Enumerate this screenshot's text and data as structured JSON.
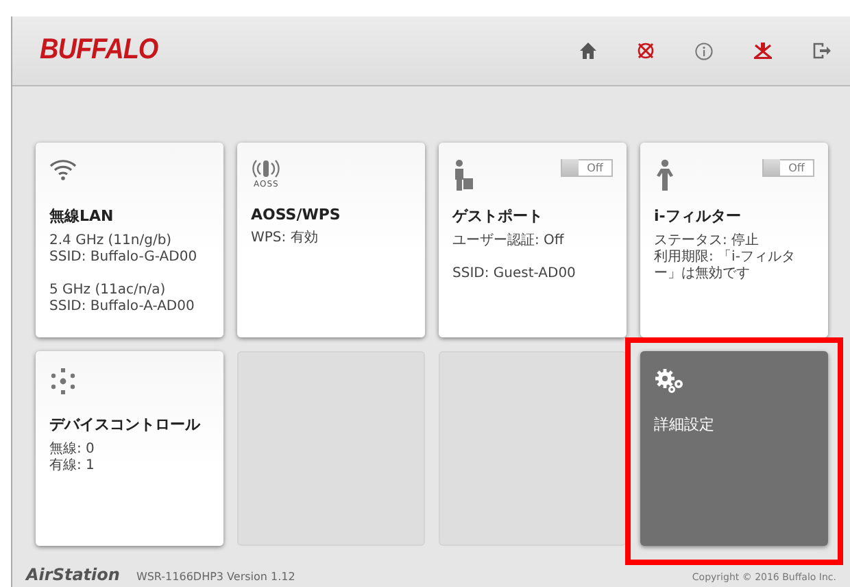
{
  "header": {
    "logo": "BUFFALO"
  },
  "tiles": [
    {
      "kind": "tile",
      "title": "無線LAN",
      "groups": [
        [
          "2.4 GHz (11n/g/b)",
          "SSID: Buffalo-G-AD00"
        ],
        [
          "5 GHz (11ac/n/a)",
          "SSID: Buffalo-A-AD00"
        ]
      ]
    },
    {
      "kind": "tile",
      "icon_caption": "AOSS",
      "title": "AOSS/WPS",
      "groups": [
        [
          "WPS: 有効"
        ]
      ]
    },
    {
      "kind": "tile",
      "toggle": {
        "on": false,
        "label": "Off"
      },
      "title": "ゲストポート",
      "groups": [
        [
          "ユーザー認証: Off"
        ],
        [
          "SSID: Guest-AD00"
        ]
      ]
    },
    {
      "kind": "tile",
      "toggle": {
        "on": false,
        "label": "Off"
      },
      "title": "i-フィルター",
      "groups": [
        [
          "ステータス: 停止",
          "利用期限: 「i-フィルター」は無効です"
        ]
      ]
    },
    {
      "kind": "tile",
      "title": "デバイスコントロール",
      "groups": [
        [
          "無線: 0",
          "有線: 1"
        ]
      ]
    },
    {
      "kind": "empty"
    },
    {
      "kind": "empty"
    },
    {
      "kind": "dark",
      "title": "詳細設定",
      "highlighted": true
    }
  ],
  "footer": {
    "brand": "AirStation",
    "model": "WSR-1166DHP3 Version 1.12",
    "copyright": "Copyright © 2016 Buffalo Inc."
  }
}
